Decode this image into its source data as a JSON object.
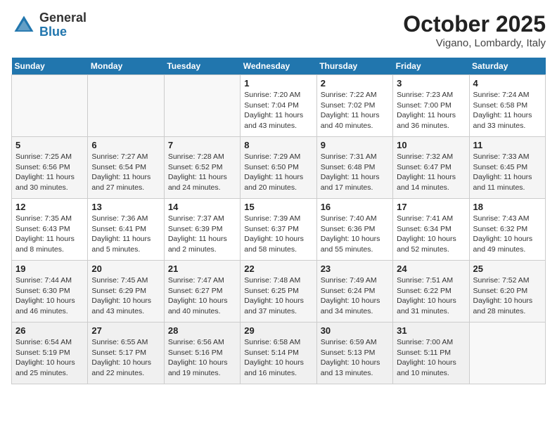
{
  "header": {
    "logo_general": "General",
    "logo_blue": "Blue",
    "month": "October 2025",
    "location": "Vigano, Lombardy, Italy"
  },
  "weekdays": [
    "Sunday",
    "Monday",
    "Tuesday",
    "Wednesday",
    "Thursday",
    "Friday",
    "Saturday"
  ],
  "weeks": [
    [
      {
        "day": "",
        "info": ""
      },
      {
        "day": "",
        "info": ""
      },
      {
        "day": "",
        "info": ""
      },
      {
        "day": "1",
        "info": "Sunrise: 7:20 AM\nSunset: 7:04 PM\nDaylight: 11 hours\nand 43 minutes."
      },
      {
        "day": "2",
        "info": "Sunrise: 7:22 AM\nSunset: 7:02 PM\nDaylight: 11 hours\nand 40 minutes."
      },
      {
        "day": "3",
        "info": "Sunrise: 7:23 AM\nSunset: 7:00 PM\nDaylight: 11 hours\nand 36 minutes."
      },
      {
        "day": "4",
        "info": "Sunrise: 7:24 AM\nSunset: 6:58 PM\nDaylight: 11 hours\nand 33 minutes."
      }
    ],
    [
      {
        "day": "5",
        "info": "Sunrise: 7:25 AM\nSunset: 6:56 PM\nDaylight: 11 hours\nand 30 minutes."
      },
      {
        "day": "6",
        "info": "Sunrise: 7:27 AM\nSunset: 6:54 PM\nDaylight: 11 hours\nand 27 minutes."
      },
      {
        "day": "7",
        "info": "Sunrise: 7:28 AM\nSunset: 6:52 PM\nDaylight: 11 hours\nand 24 minutes."
      },
      {
        "day": "8",
        "info": "Sunrise: 7:29 AM\nSunset: 6:50 PM\nDaylight: 11 hours\nand 20 minutes."
      },
      {
        "day": "9",
        "info": "Sunrise: 7:31 AM\nSunset: 6:48 PM\nDaylight: 11 hours\nand 17 minutes."
      },
      {
        "day": "10",
        "info": "Sunrise: 7:32 AM\nSunset: 6:47 PM\nDaylight: 11 hours\nand 14 minutes."
      },
      {
        "day": "11",
        "info": "Sunrise: 7:33 AM\nSunset: 6:45 PM\nDaylight: 11 hours\nand 11 minutes."
      }
    ],
    [
      {
        "day": "12",
        "info": "Sunrise: 7:35 AM\nSunset: 6:43 PM\nDaylight: 11 hours\nand 8 minutes."
      },
      {
        "day": "13",
        "info": "Sunrise: 7:36 AM\nSunset: 6:41 PM\nDaylight: 11 hours\nand 5 minutes."
      },
      {
        "day": "14",
        "info": "Sunrise: 7:37 AM\nSunset: 6:39 PM\nDaylight: 11 hours\nand 2 minutes."
      },
      {
        "day": "15",
        "info": "Sunrise: 7:39 AM\nSunset: 6:37 PM\nDaylight: 10 hours\nand 58 minutes."
      },
      {
        "day": "16",
        "info": "Sunrise: 7:40 AM\nSunset: 6:36 PM\nDaylight: 10 hours\nand 55 minutes."
      },
      {
        "day": "17",
        "info": "Sunrise: 7:41 AM\nSunset: 6:34 PM\nDaylight: 10 hours\nand 52 minutes."
      },
      {
        "day": "18",
        "info": "Sunrise: 7:43 AM\nSunset: 6:32 PM\nDaylight: 10 hours\nand 49 minutes."
      }
    ],
    [
      {
        "day": "19",
        "info": "Sunrise: 7:44 AM\nSunset: 6:30 PM\nDaylight: 10 hours\nand 46 minutes."
      },
      {
        "day": "20",
        "info": "Sunrise: 7:45 AM\nSunset: 6:29 PM\nDaylight: 10 hours\nand 43 minutes."
      },
      {
        "day": "21",
        "info": "Sunrise: 7:47 AM\nSunset: 6:27 PM\nDaylight: 10 hours\nand 40 minutes."
      },
      {
        "day": "22",
        "info": "Sunrise: 7:48 AM\nSunset: 6:25 PM\nDaylight: 10 hours\nand 37 minutes."
      },
      {
        "day": "23",
        "info": "Sunrise: 7:49 AM\nSunset: 6:24 PM\nDaylight: 10 hours\nand 34 minutes."
      },
      {
        "day": "24",
        "info": "Sunrise: 7:51 AM\nSunset: 6:22 PM\nDaylight: 10 hours\nand 31 minutes."
      },
      {
        "day": "25",
        "info": "Sunrise: 7:52 AM\nSunset: 6:20 PM\nDaylight: 10 hours\nand 28 minutes."
      }
    ],
    [
      {
        "day": "26",
        "info": "Sunrise: 6:54 AM\nSunset: 5:19 PM\nDaylight: 10 hours\nand 25 minutes."
      },
      {
        "day": "27",
        "info": "Sunrise: 6:55 AM\nSunset: 5:17 PM\nDaylight: 10 hours\nand 22 minutes."
      },
      {
        "day": "28",
        "info": "Sunrise: 6:56 AM\nSunset: 5:16 PM\nDaylight: 10 hours\nand 19 minutes."
      },
      {
        "day": "29",
        "info": "Sunrise: 6:58 AM\nSunset: 5:14 PM\nDaylight: 10 hours\nand 16 minutes."
      },
      {
        "day": "30",
        "info": "Sunrise: 6:59 AM\nSunset: 5:13 PM\nDaylight: 10 hours\nand 13 minutes."
      },
      {
        "day": "31",
        "info": "Sunrise: 7:00 AM\nSunset: 5:11 PM\nDaylight: 10 hours\nand 10 minutes."
      },
      {
        "day": "",
        "info": ""
      }
    ]
  ]
}
